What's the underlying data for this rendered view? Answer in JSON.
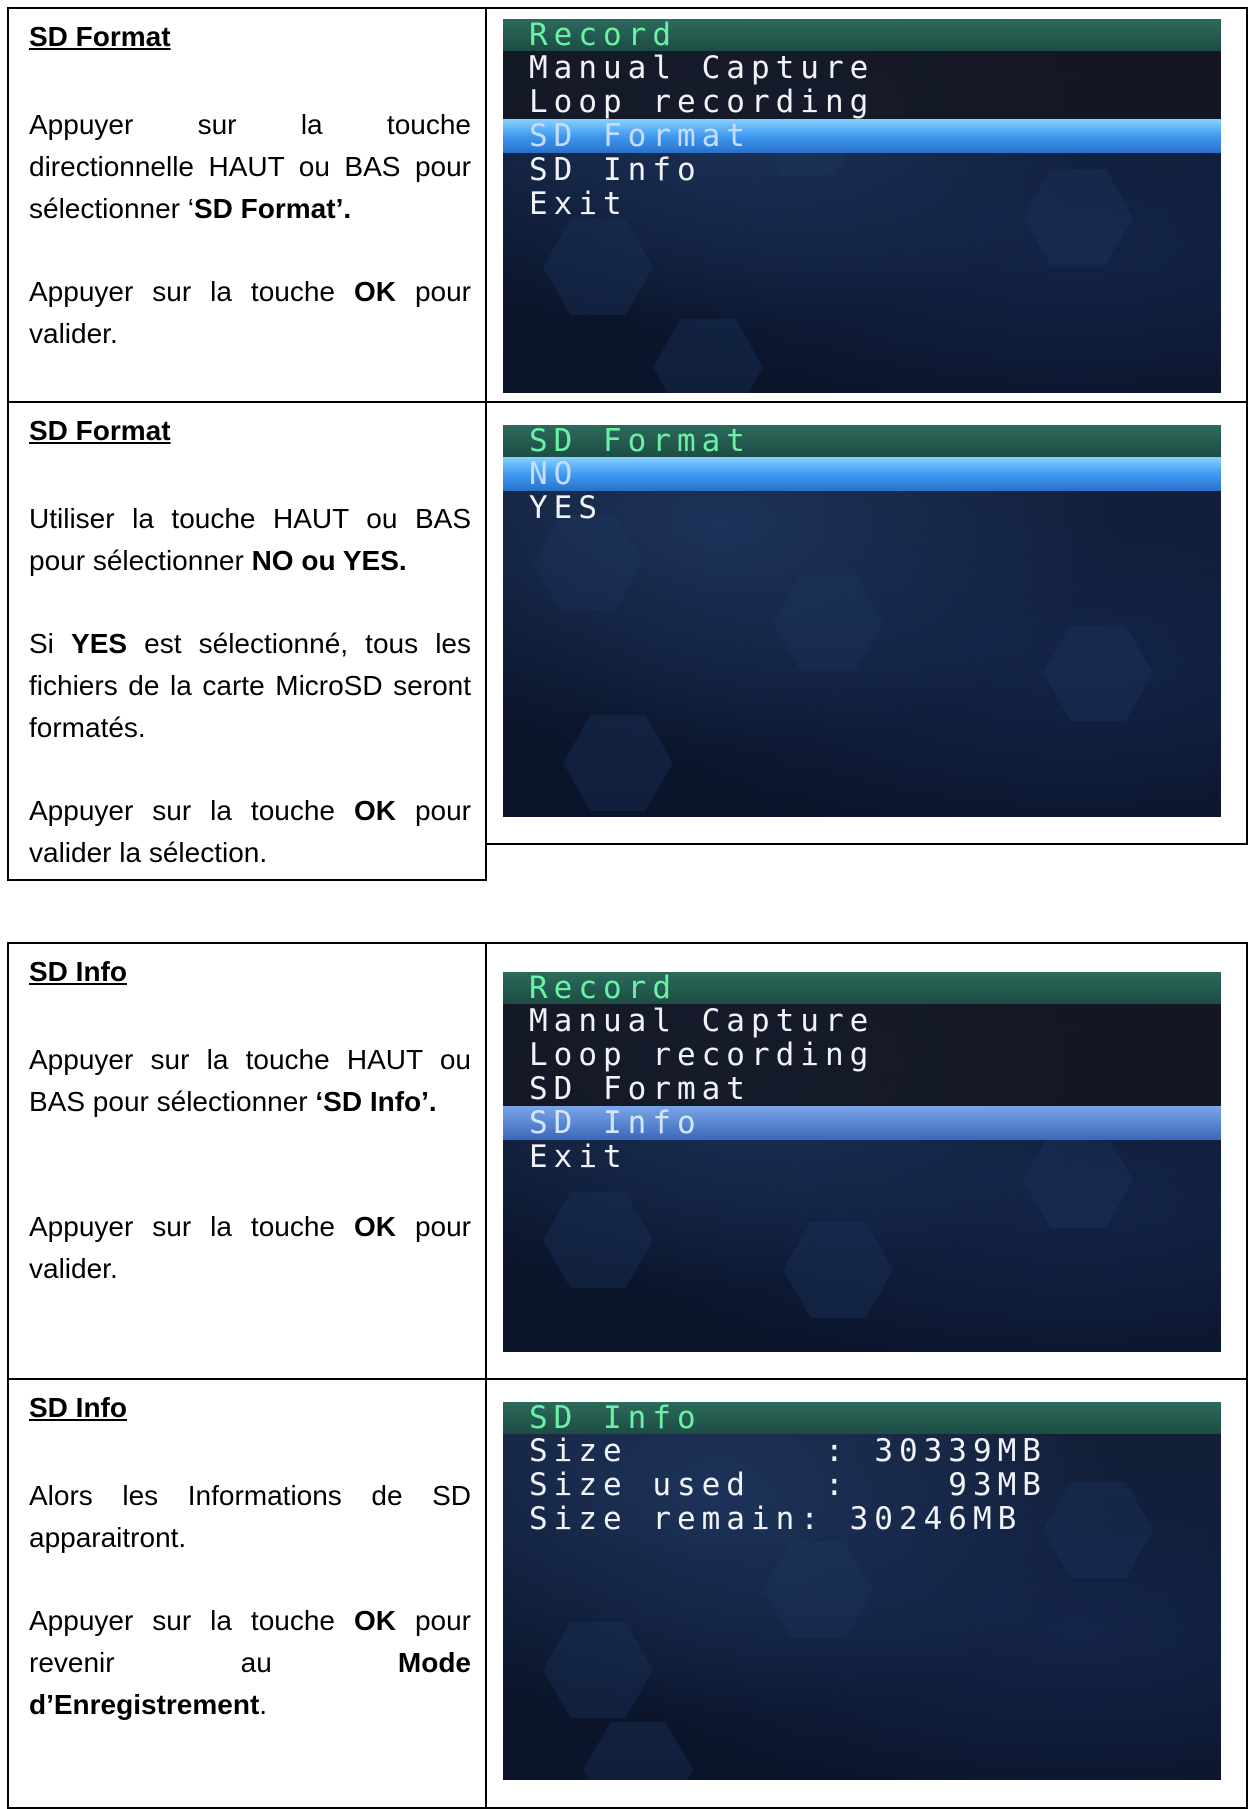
{
  "sections": [
    {
      "heading": "SD Format",
      "para1_parts": [
        "Appuyer sur la touche directionnelle HAUT ou BAS pour sélectionner ‘",
        "SD Format",
        "’."
      ],
      "para2_parts": [
        "Appuyer sur la touche ",
        "OK",
        " pour valider."
      ],
      "screen": {
        "title": "Record",
        "items": [
          "Manual Capture",
          "Loop recording",
          "SD Format",
          "SD Info",
          "Exit"
        ],
        "selected": "SD Format"
      }
    },
    {
      "heading": "SD Format",
      "para1_parts": [
        "Utiliser la touche HAUT ou BAS pour sélectionner ",
        "NO ou YES."
      ],
      "para1b_parts": [
        "Si ",
        "YES",
        " est sélectionné, tous les fichiers de la carte MicroSD seront formatés."
      ],
      "para2_parts": [
        "Appuyer sur la touche ",
        "OK",
        " pour valider la sélection."
      ],
      "screen": {
        "title": "SD Format",
        "items": [
          "NO",
          "YES"
        ],
        "selected": "NO"
      }
    },
    {
      "heading": "SD Info",
      "para1_parts": [
        "Appuyer sur la touche HAUT ou BAS pour sélectionner ",
        "‘SD Info’."
      ],
      "para2_parts": [
        "Appuyer sur la touche ",
        "OK",
        " pour valider."
      ],
      "screen": {
        "title": "Record",
        "items": [
          "Manual Capture",
          "Loop recording",
          "SD Format",
          "SD Info",
          "Exit"
        ],
        "selected": "SD Info"
      }
    },
    {
      "heading": "SD Info",
      "para1": "Alors les Informations de SD apparaitront.",
      "para2_parts": [
        "Appuyer sur la touche ",
        "OK",
        " pour revenir au ",
        "Mode d’Enregistrement",
        "."
      ],
      "screen": {
        "title": "SD Info",
        "rows": [
          {
            "label": "Size        :",
            "value": "30339MB"
          },
          {
            "label": "Size used   :",
            "value": "   93MB"
          },
          {
            "label": "Size remain:",
            "value": "30246MB"
          }
        ]
      }
    }
  ]
}
